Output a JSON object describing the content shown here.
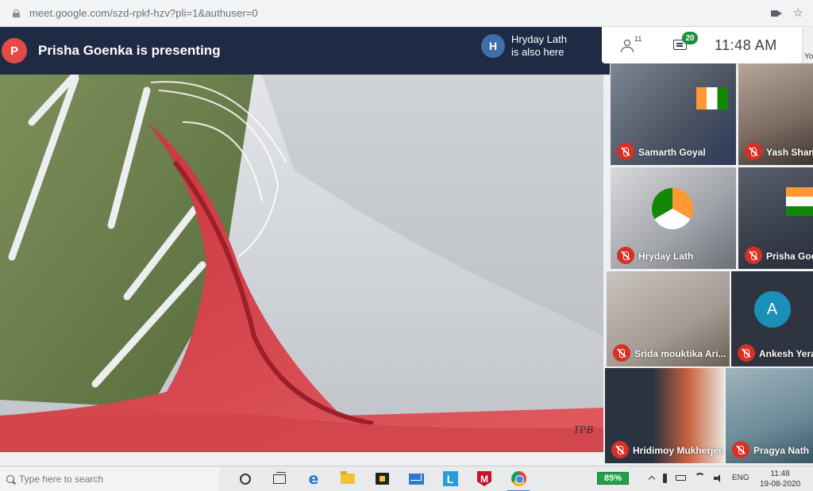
{
  "browser": {
    "url": "meet.google.com/szd-rpkf-hzv?pli=1&authuser=0",
    "icons": [
      "lock-icon",
      "camera-icon",
      "star-icon"
    ]
  },
  "presenter": {
    "avatar_letter": "P",
    "title": "Prisha Goenka is presenting",
    "also_avatar_letter": "H",
    "also_line1": "Hryday Lath",
    "also_line2": "is also here",
    "avatar_color": "#e34b44",
    "also_avatar_color": "#3f6fa8",
    "bar_color": "#1f2a44"
  },
  "topbar": {
    "people_count": "11",
    "chat_count": "20",
    "time": "11:48 AM",
    "you_label": "Yo"
  },
  "stage": {
    "watermark": "TPB"
  },
  "tiles": [
    {
      "name": "Samarth Goyal"
    },
    {
      "name": "Yash Shan"
    },
    {
      "name": "Hryday Lath"
    },
    {
      "name": "Prisha Goe"
    },
    {
      "name": "Srida mouktika Ari..."
    },
    {
      "name": "Ankesh Yera",
      "avatar_letter": "A"
    },
    {
      "name": "Hridimoy Mukherjee"
    },
    {
      "name": "Pragya Nath"
    }
  ],
  "taskbar": {
    "search_placeholder": "Type here to search",
    "battery": "85%",
    "lang": "ENG",
    "time": "11:48",
    "date": "19-08-2020",
    "accent": "#22a04a"
  }
}
